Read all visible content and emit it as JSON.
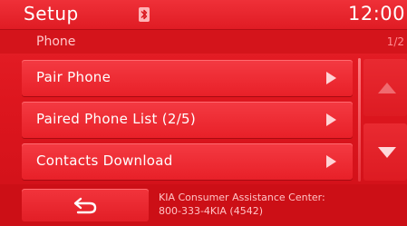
{
  "header": {
    "title": "Setup",
    "status_icon": "bluetooth-icon",
    "time": "12:00"
  },
  "subheader": {
    "section": "Phone",
    "page": "1/2"
  },
  "menu": {
    "items": [
      {
        "label": "Pair Phone",
        "icon": "play-arrow-icon"
      },
      {
        "label": "Paired Phone List (2/5)",
        "icon": "play-arrow-icon"
      },
      {
        "label": "Contacts Download",
        "icon": "play-arrow-icon"
      }
    ]
  },
  "scroll": {
    "up_icon": "scroll-up-icon",
    "down_icon": "scroll-down-icon"
  },
  "footer": {
    "back_icon": "back-icon",
    "assist_line1": "KIA Consumer Assistance Center:",
    "assist_line2": "800-333-4KIA (4542)"
  },
  "colors": {
    "background": "#d9121a",
    "button": "#e82028",
    "text": "#ffffff"
  }
}
